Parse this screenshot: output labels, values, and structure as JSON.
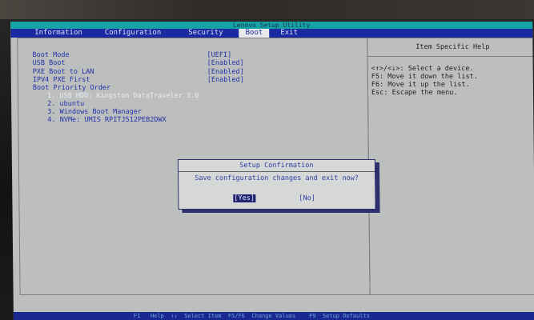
{
  "app_title": "Lenovo Setup Utility",
  "menu": [
    {
      "label": "Information"
    },
    {
      "label": "Configuration"
    },
    {
      "label": "Security"
    },
    {
      "label": "Boot"
    },
    {
      "label": "Exit"
    }
  ],
  "boot_settings": [
    {
      "label": "Boot Mode",
      "value": "[UEFI]"
    },
    {
      "label": "USB Boot",
      "value": "[Enabled]"
    },
    {
      "label": "PXE Boot to LAN",
      "value": "[Enabled]"
    },
    {
      "label": "IPV4 PXE First",
      "value": "[Enabled]"
    }
  ],
  "boot_priority": {
    "heading": "Boot Priority Order",
    "items": [
      "1. USB HDD: Kingston DataTraveler 3.0",
      "2. ubuntu",
      "3. Windows Boot Manager",
      "4. NVMe: UMIS RPITJ512PEB2DWX"
    ]
  },
  "help": {
    "title": "Item Specific Help",
    "lines": [
      "<↑>/<↓>: Select a device.",
      "F5: Move it down the list.",
      "F6: Move it up the list.",
      "Esc: Escape the menu."
    ]
  },
  "dialog": {
    "title": "Setup Confirmation",
    "message": "Save configuration changes and exit now?",
    "yes_label": "[Yes]",
    "no_label": "[No]"
  },
  "bottom_bar": "F1   Help  ↑↓  Select Item  F5/F6  Change Values    F9  Setup Defaults",
  "colors": {
    "title_bar": "#17a2a6",
    "menu_bar": "#1b2aa0",
    "background": "#bdbfbe",
    "text_blue": "#2031a8"
  }
}
